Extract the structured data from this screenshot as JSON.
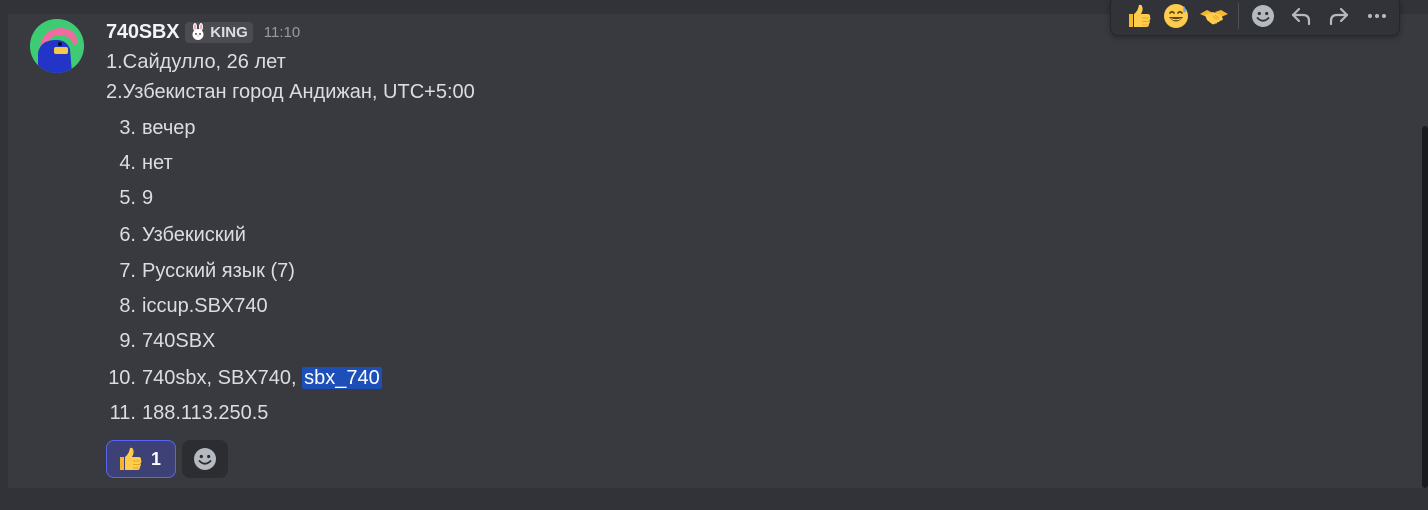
{
  "message": {
    "author": "740SBX",
    "role_tag": "KING",
    "timestamp": "11:10",
    "lines": [
      "1.Сайдулло, 26 лет",
      "2.Узбекистан город Андижан, UTC+5:00"
    ],
    "list": [
      {
        "num": "3.",
        "text": "вечер"
      },
      {
        "num": "4.",
        "text": "нет"
      },
      {
        "num": "5.",
        "text": "9"
      },
      {
        "num": "6.",
        "text": "Узбекиский"
      },
      {
        "num": "7.",
        "text": "Русский язык (7)"
      },
      {
        "num": "8.",
        "text": "iccup.SBX740"
      },
      {
        "num": "9.",
        "text": "740SBX"
      },
      {
        "num": "10.",
        "text": "740sbx, SBX740, ",
        "highlighted": "sbx_740"
      },
      {
        "num": "11.",
        "text": "188.113.250.5"
      }
    ]
  },
  "reactions": [
    {
      "emoji": "thumbs-up-icon",
      "count": "1",
      "selected": true
    }
  ],
  "toolbar": {
    "quick_reactions": [
      "thumbs-up-icon",
      "sweat-smile-icon",
      "handshake-icon"
    ],
    "actions": [
      "add-reaction-icon",
      "reply-icon",
      "forward-icon",
      "more-icon"
    ]
  },
  "colors": {
    "background": "#313338",
    "message_hover": "#393a40",
    "accent": "#5865f2",
    "selection": "#1d4fb8"
  }
}
